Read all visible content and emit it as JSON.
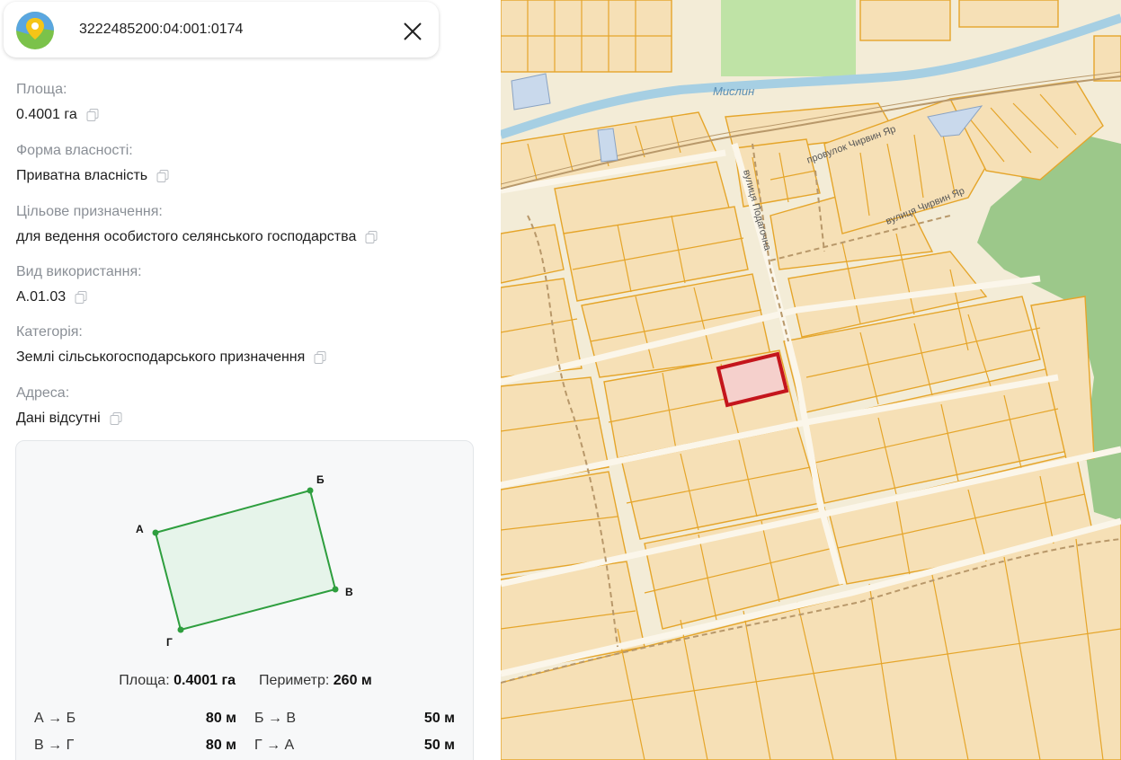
{
  "header": {
    "cadastral_number": "3222485200:04:001:0174",
    "close_icon": "close-icon",
    "logo_icon": "map-pin-logo-icon"
  },
  "fields": [
    {
      "label": "Площа:",
      "value": "0.4001 га"
    },
    {
      "label": "Форма власності:",
      "value": "Приватна власність"
    },
    {
      "label": "Цільове призначення:",
      "value": "для ведення особистого селянського господарства"
    },
    {
      "label": "Вид використання:",
      "value": "A.01.03"
    },
    {
      "label": "Категорія:",
      "value": "Землі сільськогосподарського призначення"
    },
    {
      "label": "Адреса:",
      "value": "Дані відсутні"
    }
  ],
  "parcel": {
    "vertices": [
      "А",
      "Б",
      "В",
      "Г"
    ],
    "area_label": "Площа:",
    "area_value": "0.4001 га",
    "perimeter_label": "Периметр:",
    "perimeter_value": "260 м",
    "sides": [
      {
        "name": "А → Б",
        "length": "80 м"
      },
      {
        "name": "Б → В",
        "length": "50 м"
      },
      {
        "name": "В → Г",
        "length": "80 м"
      },
      {
        "name": "Г → А",
        "length": "50 м"
      }
    ],
    "fill_color": "#e6f4ea",
    "stroke_color": "#2e9e3e"
  },
  "map": {
    "labels": {
      "river": "Мислин",
      "lane": "провулок Чирвин Яр",
      "street1": "вулиця Подагочна",
      "street2": "вулиця Чирвин Яр"
    },
    "colors": {
      "parcel_fill": "#f6e0b6",
      "parcel_border": "#e5a52a",
      "selected_border": "#c4151c",
      "river": "#a6cfe3",
      "forest": "#9cc88a"
    }
  }
}
